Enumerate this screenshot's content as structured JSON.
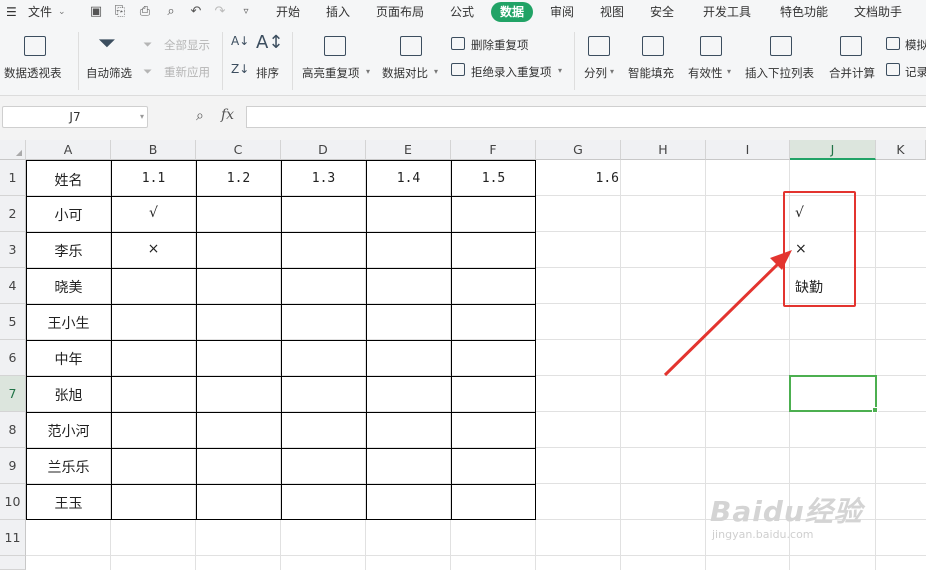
{
  "menu": {
    "file": "文件",
    "tabs": [
      "开始",
      "插入",
      "页面布局",
      "公式",
      "数据",
      "审阅",
      "视图",
      "安全",
      "开发工具",
      "特色功能",
      "文档助手"
    ],
    "active_tab": "数据"
  },
  "ribbon": {
    "pivot": "数据透视表",
    "autofilter": "自动筛选",
    "show_all": "全部显示",
    "reapply": "重新应用",
    "sort": "排序",
    "highlight_dup": "高亮重复项",
    "compare": "数据对比",
    "remove_dup": "删除重复项",
    "reject_dup": "拒绝录入重复项",
    "split": "分列",
    "smart_fill": "智能填充",
    "validity": "有效性",
    "insert_dropdown": "插入下拉列表",
    "merge_calc": "合并计算",
    "template": "模拟",
    "record": "记录"
  },
  "formula_bar": {
    "name_box": "J7",
    "fx": "fx",
    "value": ""
  },
  "columns": [
    "A",
    "B",
    "C",
    "D",
    "E",
    "F",
    "G",
    "H",
    "I",
    "J",
    "K"
  ],
  "rows": [
    "1",
    "2",
    "3",
    "4",
    "5",
    "6",
    "7",
    "8",
    "9",
    "10",
    "11"
  ],
  "table": {
    "header": [
      "姓名",
      "1.1",
      "1.2",
      "1.3",
      "1.4",
      "1.5",
      "1.6"
    ],
    "names": [
      "小可",
      "李乐",
      "晓美",
      "王小生",
      "中年",
      "张旭",
      "范小河",
      "兰乐乐",
      "王玉"
    ],
    "b_values": [
      "√",
      "×"
    ]
  },
  "options_list": [
    "√",
    "×",
    "缺勤"
  ],
  "selected_cell": "J7",
  "accent": "#21a366",
  "annotation_color": "#e3342f",
  "watermark": {
    "logo": "Baidu经验",
    "url": "jingyan.baidu.com"
  }
}
